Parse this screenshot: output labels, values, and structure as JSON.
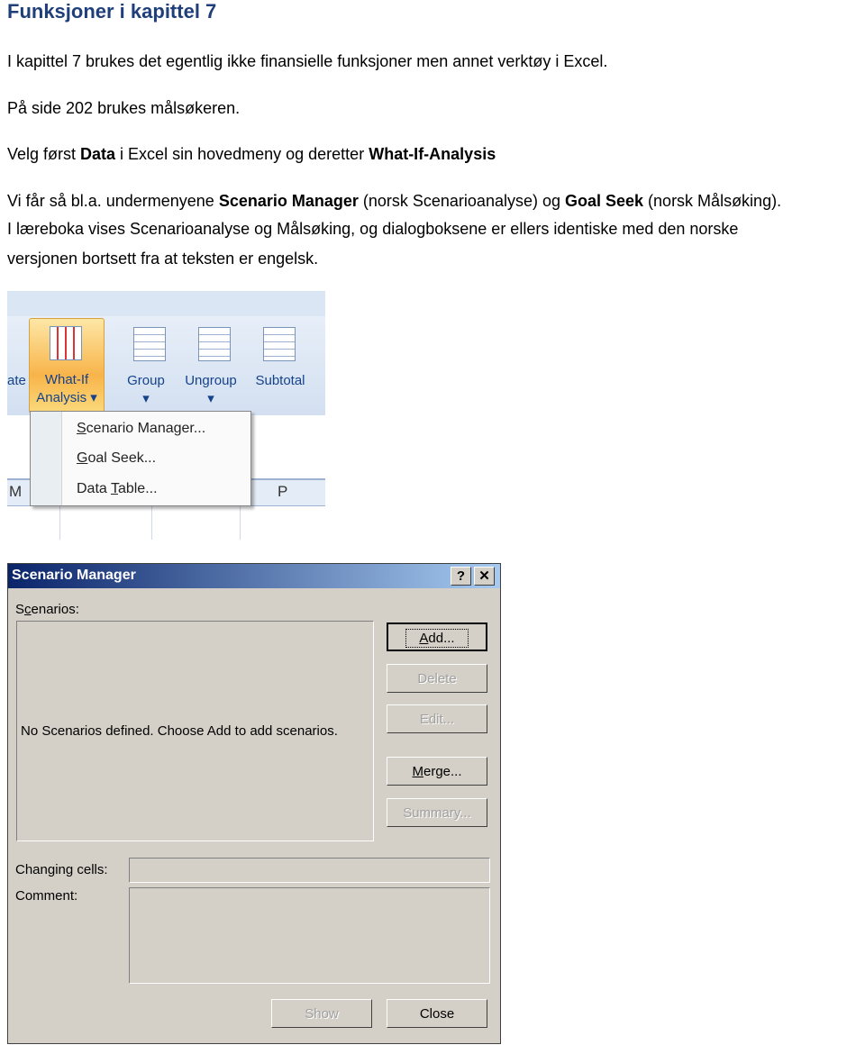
{
  "heading": "Funksjoner i kapittel 7",
  "paragraphs": {
    "p1": "I kapittel 7 brukes det egentlig ikke finansielle funksjoner men annet verktøy i Excel.",
    "p2": "På side 202 brukes målsøkeren.",
    "p3a": "Velg først ",
    "p3b": "Data",
    "p3c": " i Excel sin hovedmeny og deretter ",
    "p3d": "What-If-Analysis",
    "p4a": "Vi får så bl.a. undermenyene ",
    "p4b": "Scenario Manager",
    "p4c": " (norsk Scenarioanalyse) og ",
    "p4d": "Goal Seek",
    "p4e": " (norsk Målsøking).",
    "p5": "I læreboka vises Scenarioanalyse og Målsøking, og dialogboksene er ellers identiske med den norske",
    "p6": "versjonen bortsett fra at teksten er engelsk."
  },
  "ribbon": {
    "partial_label": "ate",
    "whatif_line1": "What-If",
    "whatif_line2": "Analysis",
    "group": "Group",
    "ungroup": "Ungroup",
    "subtotal": "Subtotal",
    "col_m": "M",
    "col_p": "P",
    "menu": {
      "scenario_pre": "",
      "scenario_u": "S",
      "scenario_rest": "cenario Manager...",
      "goal_u": "G",
      "goal_rest": "oal Seek...",
      "table_pre": "Data ",
      "table_u": "T",
      "table_rest": "able..."
    }
  },
  "dialog": {
    "title": "Scenario Manager",
    "help": "?",
    "close_x": "✕",
    "scenarios_pre": "S",
    "scenarios_u": "c",
    "scenarios_rest": "enarios:",
    "empty_text": "No Scenarios defined. Choose Add to add scenarios.",
    "add_u": "A",
    "add_rest": "dd...",
    "delete": "Delete",
    "edit": "Edit...",
    "merge_u": "M",
    "merge_rest": "erge...",
    "summary": "Summary...",
    "changing_cells": "Changing cells:",
    "comment": "Comment:",
    "show": "Show",
    "close": "Close"
  }
}
